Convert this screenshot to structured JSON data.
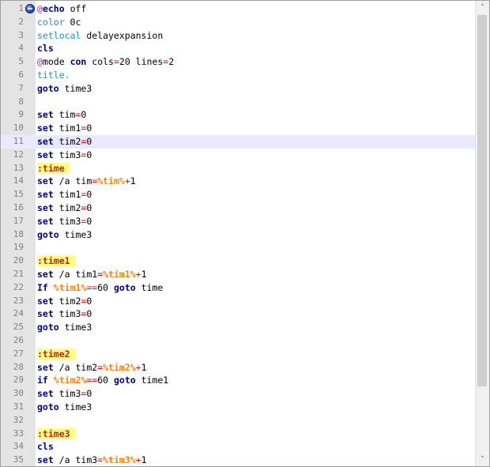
{
  "editor": {
    "current_line": 11,
    "lines": [
      {
        "n": "1",
        "segs": [
          {
            "t": "@",
            "c": "at"
          },
          {
            "t": "echo",
            "c": "kw"
          },
          {
            "t": " off",
            "c": ""
          }
        ]
      },
      {
        "n": "2",
        "segs": [
          {
            "t": "color",
            "c": "cmd"
          },
          {
            "t": " 0c",
            "c": ""
          }
        ]
      },
      {
        "n": "3",
        "segs": [
          {
            "t": "setlocal",
            "c": "cmd"
          },
          {
            "t": " delayexpansion",
            "c": ""
          }
        ]
      },
      {
        "n": "4",
        "segs": [
          {
            "t": "cls",
            "c": "kw"
          }
        ]
      },
      {
        "n": "5",
        "segs": [
          {
            "t": "@",
            "c": "at"
          },
          {
            "t": "mode ",
            "c": ""
          },
          {
            "t": "con",
            "c": "kw"
          },
          {
            "t": " cols",
            "c": ""
          },
          {
            "t": "=",
            "c": "op"
          },
          {
            "t": "20 lines",
            "c": ""
          },
          {
            "t": "=",
            "c": "op"
          },
          {
            "t": "2",
            "c": ""
          }
        ]
      },
      {
        "n": "6",
        "segs": [
          {
            "t": "title.",
            "c": "cmd"
          }
        ]
      },
      {
        "n": "7",
        "segs": [
          {
            "t": "goto",
            "c": "kw"
          },
          {
            "t": " time3",
            "c": ""
          }
        ]
      },
      {
        "n": "8",
        "segs": []
      },
      {
        "n": "9",
        "segs": [
          {
            "t": "set",
            "c": "kw"
          },
          {
            "t": " tim",
            "c": ""
          },
          {
            "t": "=",
            "c": "op"
          },
          {
            "t": "0",
            "c": ""
          }
        ]
      },
      {
        "n": "10",
        "segs": [
          {
            "t": "set",
            "c": "kw"
          },
          {
            "t": " tim1",
            "c": ""
          },
          {
            "t": "=",
            "c": "op"
          },
          {
            "t": "0",
            "c": ""
          }
        ]
      },
      {
        "n": "11",
        "segs": [
          {
            "t": "set",
            "c": "kw"
          },
          {
            "t": " tim2",
            "c": ""
          },
          {
            "t": "=",
            "c": "op"
          },
          {
            "t": "0",
            "c": ""
          }
        ]
      },
      {
        "n": "12",
        "segs": [
          {
            "t": "set",
            "c": "kw"
          },
          {
            "t": " tim3",
            "c": ""
          },
          {
            "t": "=",
            "c": "op"
          },
          {
            "t": "0",
            "c": ""
          }
        ]
      },
      {
        "n": "13",
        "segs": [
          {
            "t": ":time",
            "c": "lbl"
          }
        ]
      },
      {
        "n": "14",
        "segs": [
          {
            "t": "set",
            "c": "kw"
          },
          {
            "t": " /a tim",
            "c": ""
          },
          {
            "t": "=",
            "c": "op"
          },
          {
            "t": "%tim%",
            "c": "var"
          },
          {
            "t": "+",
            "c": "op"
          },
          {
            "t": "1",
            "c": ""
          }
        ]
      },
      {
        "n": "15",
        "segs": [
          {
            "t": "set",
            "c": "kw"
          },
          {
            "t": " tim1",
            "c": ""
          },
          {
            "t": "=",
            "c": "op"
          },
          {
            "t": "0",
            "c": ""
          }
        ]
      },
      {
        "n": "16",
        "segs": [
          {
            "t": "set",
            "c": "kw"
          },
          {
            "t": " tim2",
            "c": ""
          },
          {
            "t": "=",
            "c": "op"
          },
          {
            "t": "0",
            "c": ""
          }
        ]
      },
      {
        "n": "17",
        "segs": [
          {
            "t": "set",
            "c": "kw"
          },
          {
            "t": " tim3",
            "c": ""
          },
          {
            "t": "=",
            "c": "op"
          },
          {
            "t": "0",
            "c": ""
          }
        ]
      },
      {
        "n": "18",
        "segs": [
          {
            "t": "goto",
            "c": "kw"
          },
          {
            "t": " time3",
            "c": ""
          }
        ]
      },
      {
        "n": "19",
        "segs": []
      },
      {
        "n": "20",
        "segs": [
          {
            "t": ":time1",
            "c": "lbl"
          }
        ]
      },
      {
        "n": "21",
        "segs": [
          {
            "t": "set",
            "c": "kw"
          },
          {
            "t": " /a tim1",
            "c": ""
          },
          {
            "t": "=",
            "c": "op"
          },
          {
            "t": "%tim1%",
            "c": "var"
          },
          {
            "t": "+",
            "c": "op"
          },
          {
            "t": "1",
            "c": ""
          }
        ]
      },
      {
        "n": "22",
        "segs": [
          {
            "t": "If",
            "c": "kw"
          },
          {
            "t": " ",
            "c": ""
          },
          {
            "t": "%tim1%",
            "c": "var"
          },
          {
            "t": "==",
            "c": "op"
          },
          {
            "t": "60 ",
            "c": ""
          },
          {
            "t": "goto",
            "c": "kw"
          },
          {
            "t": " time",
            "c": ""
          }
        ]
      },
      {
        "n": "23",
        "segs": [
          {
            "t": "set",
            "c": "kw"
          },
          {
            "t": " tim2",
            "c": ""
          },
          {
            "t": "=",
            "c": "op"
          },
          {
            "t": "0",
            "c": ""
          }
        ]
      },
      {
        "n": "24",
        "segs": [
          {
            "t": "set",
            "c": "kw"
          },
          {
            "t": " tim3",
            "c": ""
          },
          {
            "t": "=",
            "c": "op"
          },
          {
            "t": "0",
            "c": ""
          }
        ]
      },
      {
        "n": "25",
        "segs": [
          {
            "t": "goto",
            "c": "kw"
          },
          {
            "t": " time3",
            "c": ""
          }
        ]
      },
      {
        "n": "26",
        "segs": []
      },
      {
        "n": "27",
        "segs": [
          {
            "t": ":time2",
            "c": "lbl"
          }
        ]
      },
      {
        "n": "28",
        "segs": [
          {
            "t": "set",
            "c": "kw"
          },
          {
            "t": " /a tim2",
            "c": ""
          },
          {
            "t": "=",
            "c": "op"
          },
          {
            "t": "%tim2%",
            "c": "var"
          },
          {
            "t": "+",
            "c": "op"
          },
          {
            "t": "1",
            "c": ""
          }
        ]
      },
      {
        "n": "29",
        "segs": [
          {
            "t": "if",
            "c": "kw"
          },
          {
            "t": " ",
            "c": ""
          },
          {
            "t": "%tim2%",
            "c": "var"
          },
          {
            "t": "==",
            "c": "op"
          },
          {
            "t": "60 ",
            "c": ""
          },
          {
            "t": "goto",
            "c": "kw"
          },
          {
            "t": " time1",
            "c": ""
          }
        ]
      },
      {
        "n": "30",
        "segs": [
          {
            "t": "set",
            "c": "kw"
          },
          {
            "t": " tim3",
            "c": ""
          },
          {
            "t": "=",
            "c": "op"
          },
          {
            "t": "0",
            "c": ""
          }
        ]
      },
      {
        "n": "31",
        "segs": [
          {
            "t": "goto",
            "c": "kw"
          },
          {
            "t": " time3",
            "c": ""
          }
        ]
      },
      {
        "n": "32",
        "segs": []
      },
      {
        "n": "33",
        "segs": [
          {
            "t": ":time3",
            "c": "lbl"
          }
        ]
      },
      {
        "n": "34",
        "segs": [
          {
            "t": "cls",
            "c": "kw"
          }
        ]
      },
      {
        "n": "35",
        "segs": [
          {
            "t": "set",
            "c": "kw"
          },
          {
            "t": " /a tim3",
            "c": ""
          },
          {
            "t": "=",
            "c": "op"
          },
          {
            "t": "%tim3%",
            "c": "var"
          },
          {
            "t": "+",
            "c": "op"
          },
          {
            "t": "1",
            "c": ""
          }
        ]
      }
    ]
  },
  "scrollbar": {
    "up_glyph": "˄",
    "down_glyph": "˅"
  },
  "colors": {
    "keyword": "#00008b",
    "command": "#1c8fd0",
    "operator": "#ff0000",
    "variable": "#ff8000",
    "label": "#c02020",
    "label_highlight": "#ffff80",
    "current_line": "#e8e8ff",
    "gutter": "#e4e4e4"
  },
  "icons": {
    "bookmark_marker": "bookmark-marker-icon"
  }
}
